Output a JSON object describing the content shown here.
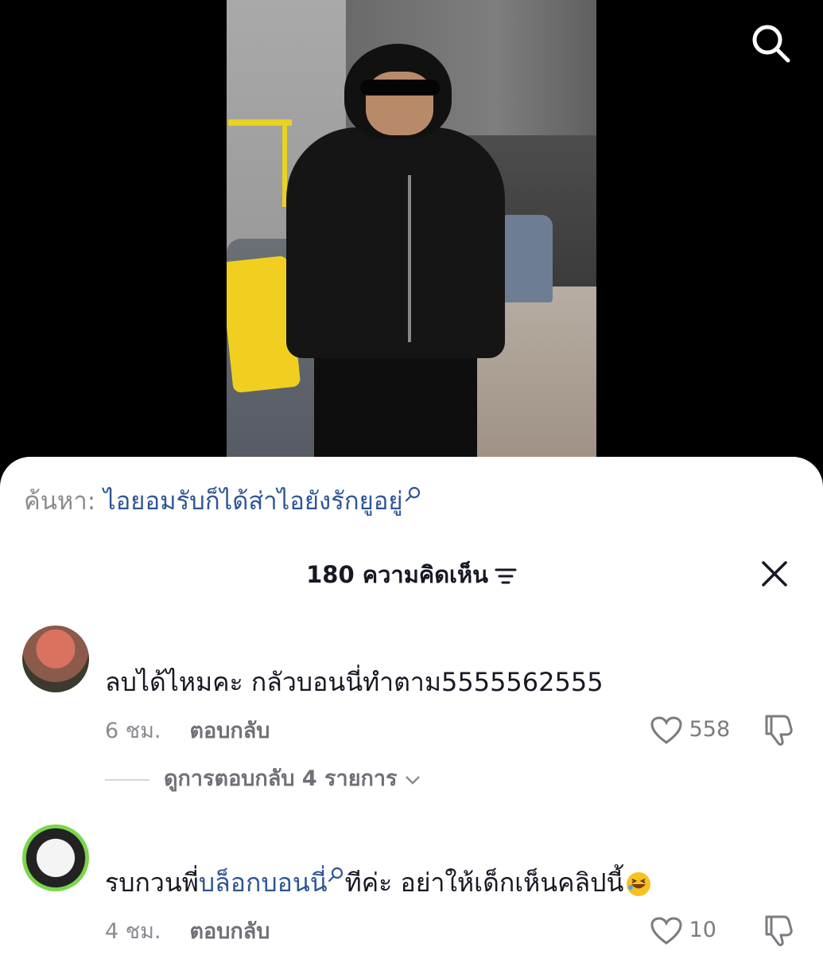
{
  "search": {
    "prefix": "ค้นหา:",
    "query": "ไอยอมรับก็ได้ส่าไอยังรักยูอยู่"
  },
  "comments_header": {
    "title": "180 ความคิดเห็น"
  },
  "comments": [
    {
      "text": "ลบได้ไหมคะ กลัวบอนนี่ทำตาม5555562555",
      "time": "6 ชม.",
      "reply_label": "ตอบกลับ",
      "likes": "558",
      "view_replies": "ดูการตอบกลับ 4 รายการ"
    },
    {
      "text_before": "รบกวนพี่",
      "text_link": "บล็อกบอนนี่",
      "text_after": "ทีค่ะ อย่าให้เด็กเห็นคลิปนี้",
      "time": "4 ชม.",
      "reply_label": "ตอบกลับ",
      "likes": "10"
    }
  ]
}
